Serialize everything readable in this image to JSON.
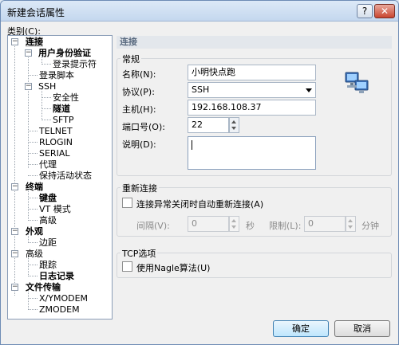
{
  "window": {
    "title": "新建会话属性",
    "help_label": "?",
    "close_label": "✕"
  },
  "category": {
    "label": "类别(C):",
    "items": [
      {
        "label": "连接",
        "bold": true,
        "selected": true,
        "expander": "−"
      },
      {
        "label": "用户身份验证",
        "bold": true,
        "expander": "−"
      },
      {
        "label": "登录提示符"
      },
      {
        "label": "登录脚本"
      },
      {
        "label": "SSH",
        "expander": "−"
      },
      {
        "label": "安全性"
      },
      {
        "label": "隧道",
        "bold": true
      },
      {
        "label": "SFTP"
      },
      {
        "label": "TELNET"
      },
      {
        "label": "RLOGIN"
      },
      {
        "label": "SERIAL"
      },
      {
        "label": "代理"
      },
      {
        "label": "保持活动状态"
      },
      {
        "label": "终端",
        "bold": true,
        "expander": "−"
      },
      {
        "label": "键盘",
        "bold": true
      },
      {
        "label": "VT 模式"
      },
      {
        "label": "高级"
      },
      {
        "label": "外观",
        "bold": true,
        "expander": "−"
      },
      {
        "label": "边距"
      },
      {
        "label": "高级",
        "expander": "−"
      },
      {
        "label": "跟踪"
      },
      {
        "label": "日志记录",
        "bold": true
      },
      {
        "label": "文件传输",
        "bold": true,
        "expander": "−"
      },
      {
        "label": "X/YMODEM"
      },
      {
        "label": "ZMODEM"
      }
    ]
  },
  "panel": {
    "header": "连接",
    "general": {
      "title": "常规",
      "name_label": "名称(N):",
      "name_value": "小明快点跑",
      "protocol_label": "协议(P):",
      "protocol_value": "SSH",
      "host_label": "主机(H):",
      "host_value": "192.168.108.37",
      "port_label": "端口号(O):",
      "port_value": "22",
      "desc_label": "说明(D):",
      "desc_value": ""
    },
    "reconnect": {
      "title": "重新连接",
      "auto_label": "连接异常关闭时自动重新连接(A)",
      "interval_label": "间隔(V):",
      "interval_value": "0",
      "seconds_unit": "秒",
      "limit_label": "限制(L):",
      "limit_value": "0",
      "minutes_unit": "分钟"
    },
    "tcp": {
      "title": "TCP选项",
      "nagle_label": "使用Nagle算法(U)"
    }
  },
  "buttons": {
    "ok": "确定",
    "cancel": "取消"
  },
  "icons": {
    "network": "network-computers-icon"
  }
}
